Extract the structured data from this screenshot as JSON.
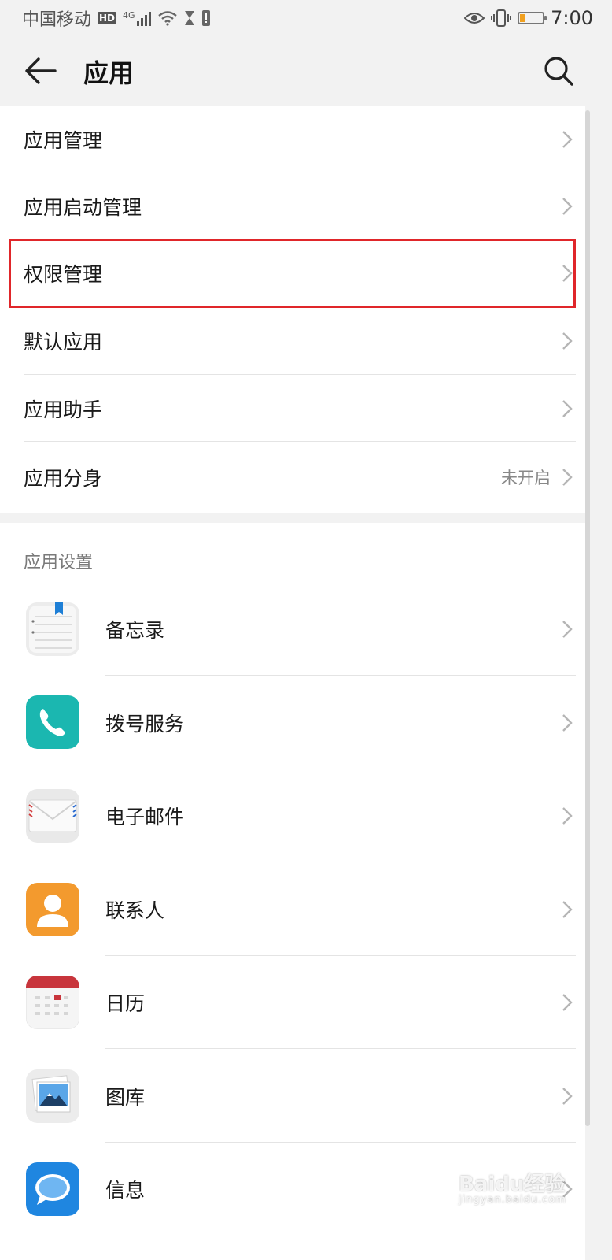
{
  "status_bar": {
    "carrier": "中国移动",
    "hd_badge": "HD",
    "network": "4G",
    "time": "7:00"
  },
  "header": {
    "title": "应用",
    "back_icon": "arrow-left-icon",
    "search_icon": "search-icon"
  },
  "menu_items": [
    {
      "label": "应用管理"
    },
    {
      "label": "应用启动管理"
    },
    {
      "label": "权限管理",
      "highlighted": true
    },
    {
      "label": "默认应用"
    },
    {
      "label": "应用助手"
    },
    {
      "label": "应用分身",
      "status": "未开启"
    }
  ],
  "app_settings": {
    "section_title": "应用设置",
    "apps": [
      {
        "label": "备忘录",
        "icon": "notepad-icon"
      },
      {
        "label": "拨号服务",
        "icon": "phone-icon"
      },
      {
        "label": "电子邮件",
        "icon": "envelope-icon"
      },
      {
        "label": "联系人",
        "icon": "contact-person-icon"
      },
      {
        "label": "日历",
        "icon": "calendar-icon"
      },
      {
        "label": "图库",
        "icon": "photo-gallery-icon"
      },
      {
        "label": "信息",
        "icon": "message-bubble-icon"
      }
    ]
  },
  "colors": {
    "highlight_box": "#e0262a",
    "background": "#f2f2f2"
  },
  "watermark": {
    "brand": "Baidu经验",
    "url": "jingyan.baidu.com"
  }
}
